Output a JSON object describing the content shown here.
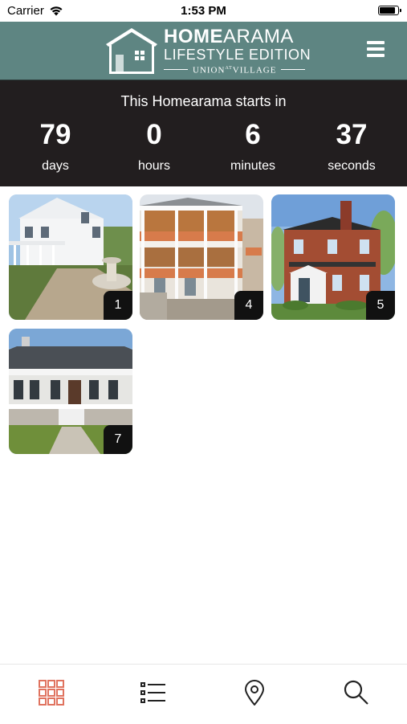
{
  "status_bar": {
    "carrier": "Carrier",
    "time": "1:53 PM",
    "battery_level": 0.9
  },
  "header": {
    "logo": {
      "line1_bold": "HOME",
      "line1_rest": "ARAMA",
      "line2": "LIFESTYLE EDITION",
      "line3": "UNION",
      "line3_small": "AT",
      "line3_rest": "VILLAGE"
    },
    "menu_icon": "hamburger-menu-icon"
  },
  "countdown": {
    "title": "This Homearama starts in",
    "units": [
      {
        "value": "79",
        "label": "days"
      },
      {
        "value": "0",
        "label": "hours"
      },
      {
        "value": "6",
        "label": "minutes"
      },
      {
        "value": "37",
        "label": "seconds"
      }
    ]
  },
  "homes": [
    {
      "number": "1"
    },
    {
      "number": "4"
    },
    {
      "number": "5"
    },
    {
      "number": "7"
    }
  ],
  "tab_bar": {
    "active_color": "#e0735f",
    "inactive_color": "#222222",
    "tabs": [
      {
        "icon": "grid-icon",
        "active": true
      },
      {
        "icon": "list-icon",
        "active": false
      },
      {
        "icon": "map-pin-icon",
        "active": false
      },
      {
        "icon": "search-icon",
        "active": false
      }
    ]
  }
}
